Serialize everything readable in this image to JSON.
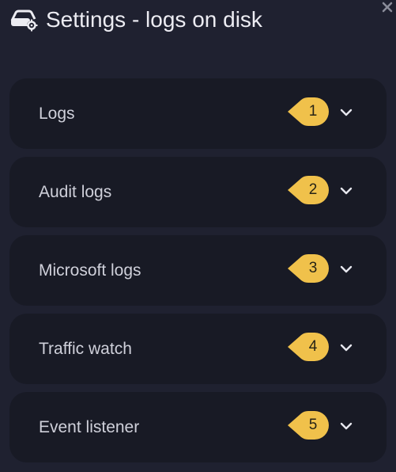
{
  "header": {
    "title": "Settings - logs on disk",
    "icon": "storage-settings-icon"
  },
  "close_icon": "close-icon",
  "sections": [
    {
      "label": "Logs",
      "badge": "1"
    },
    {
      "label": "Audit logs",
      "badge": "2"
    },
    {
      "label": "Microsoft logs",
      "badge": "3"
    },
    {
      "label": "Traffic watch",
      "badge": "4"
    },
    {
      "label": "Event listener",
      "badge": "5"
    }
  ],
  "colors": {
    "background": "#1f2130",
    "card": "#181a25",
    "badge": "#f0c14b",
    "text": "#cfd0da"
  }
}
